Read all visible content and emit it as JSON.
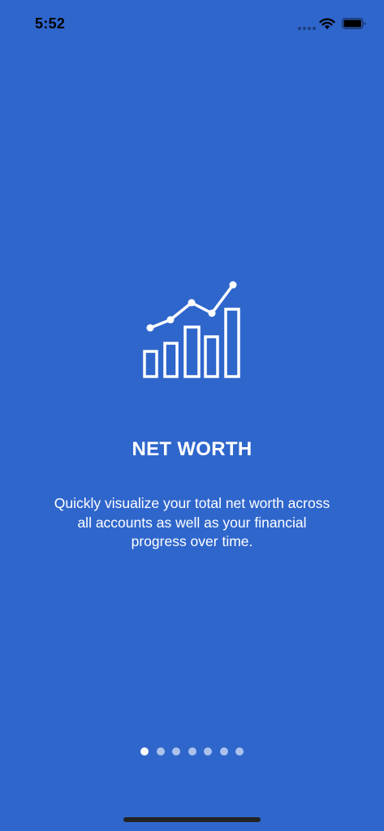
{
  "status_bar": {
    "time": "5:52",
    "icons": [
      "signal-dots-icon",
      "wifi-icon",
      "battery-icon"
    ]
  },
  "onboarding": {
    "icon": "net-worth-chart-icon",
    "title": "NET WORTH",
    "description": "Quickly visualize your total net worth across all accounts as well as your financial progress over time."
  },
  "pager": {
    "total": 7,
    "current": 1
  },
  "colors": {
    "background": "#2F66CC",
    "foreground": "#FFFFFF",
    "dot_inactive": "rgba(255,255,255,0.6)"
  }
}
